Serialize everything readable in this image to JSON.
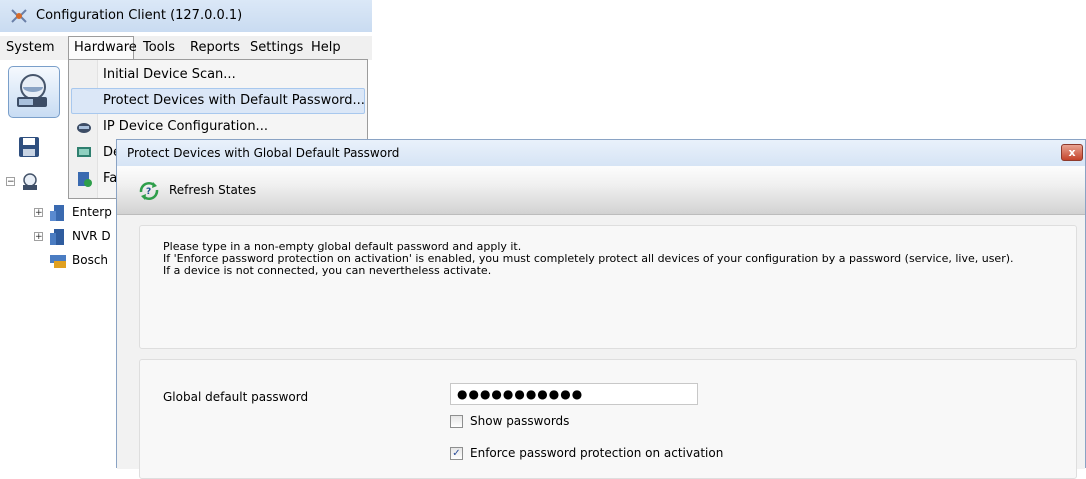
{
  "app": {
    "title": "Configuration Client (127.0.0.1)"
  },
  "menubar": {
    "items": [
      "System",
      "Hardware",
      "Tools",
      "Reports",
      "Settings",
      "Help"
    ]
  },
  "hardware_menu": {
    "items": [
      {
        "label": "Initial Device Scan...",
        "icon": ""
      },
      {
        "label": "Protect Devices with Default Password...",
        "icon": ""
      },
      {
        "label": "IP Device Configuration...",
        "icon": "network-device-icon"
      },
      {
        "label": "De",
        "icon": "device-monitor-icon"
      },
      {
        "label": "Fa",
        "icon": "device-list-icon"
      }
    ]
  },
  "tree": {
    "items": [
      {
        "label": "",
        "icon": "config-root-icon"
      },
      {
        "label": "Enterp",
        "icon": "enterprise-server-icon"
      },
      {
        "label": "NVR D",
        "icon": "nvr-icon"
      },
      {
        "label": "Bosch",
        "icon": "bosch-device-icon"
      }
    ]
  },
  "dialog": {
    "title": "Protect Devices with Global Default Password",
    "close_label": "x",
    "toolbar": {
      "refresh_label": "Refresh States"
    },
    "info_lines": [
      "Please type in a non-empty global default password and apply it.",
      "If 'Enforce password protection on activation' is enabled, you must completely protect all devices of your configuration by a password (service, live, user).",
      "If a device is not connected, you can nevertheless activate."
    ],
    "form": {
      "password_label": "Global default password",
      "password_value": "●●●●●●●●●●●",
      "show_passwords_label": "Show passwords",
      "show_passwords_checked": false,
      "enforce_label": "Enforce password protection on activation",
      "enforce_checked": true
    }
  },
  "colors": {
    "titlebar": "#c9dbf1",
    "menu_highlight": "#dbe7f7",
    "close_button": "#c4432b",
    "dialog_border": "#8aa3c4"
  }
}
